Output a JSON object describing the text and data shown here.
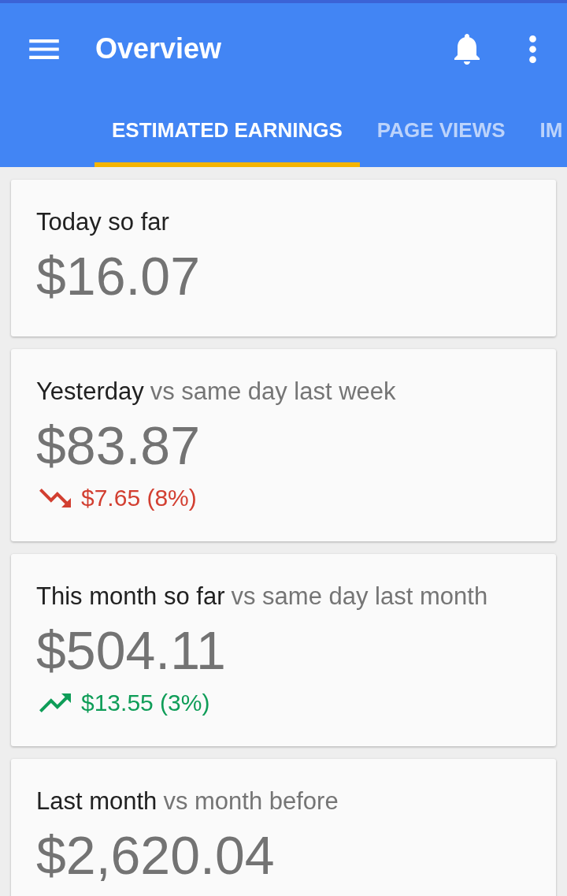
{
  "app_bar": {
    "title": "Overview"
  },
  "tabs": [
    {
      "label": "ESTIMATED EARNINGS",
      "selected": true
    },
    {
      "label": "PAGE VIEWS",
      "selected": false
    },
    {
      "label": "IM",
      "selected": false
    }
  ],
  "cards": [
    {
      "label": "Today so far",
      "amount": "$16.07"
    },
    {
      "label": "Yesterday",
      "comparison": "vs same day last week",
      "amount": "$83.87",
      "change": {
        "kind": "down",
        "text": "$7.65 (8%)"
      }
    },
    {
      "label": "This month so far",
      "comparison": "vs same day last month",
      "amount": "$504.11",
      "change": {
        "kind": "up",
        "text": "$13.55 (3%)"
      }
    },
    {
      "label": "Last month",
      "comparison": "vs month before",
      "amount": "$2,620.04"
    }
  ]
}
